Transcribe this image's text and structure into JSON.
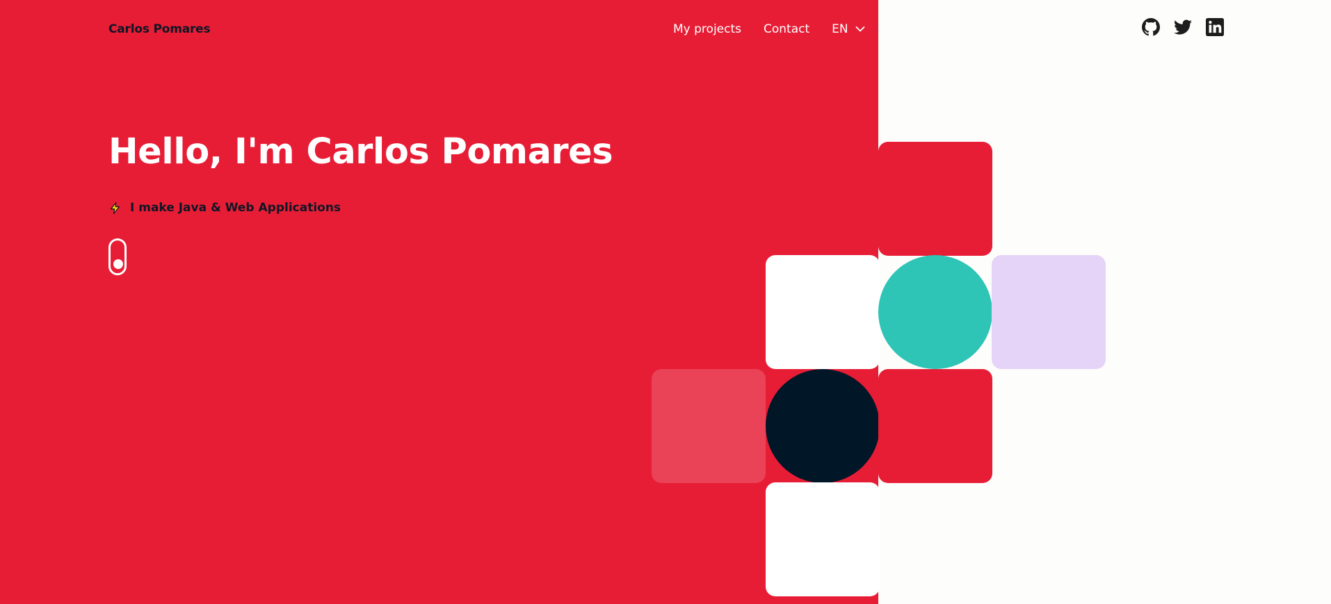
{
  "header": {
    "brand": "Carlos Pomares",
    "nav": {
      "projects": "My projects",
      "contact": "Contact",
      "language": "EN"
    },
    "social": [
      "github-icon",
      "twitter-icon",
      "linkedin-icon"
    ]
  },
  "hero": {
    "title": "Hello, I'm Carlos Pomares",
    "tagline": "I make Java & Web Applications",
    "tagline_icon": "lightning-icon",
    "scroll_icon": "mouse-scroll-icon"
  },
  "colors": {
    "accent_red": "#e71d36",
    "dark": "#011627",
    "teal": "#2ec4b6",
    "lavender": "#e5d4f7",
    "light_red": "#ea4256",
    "white": "#ffffff",
    "background": "#fdfdfb"
  }
}
